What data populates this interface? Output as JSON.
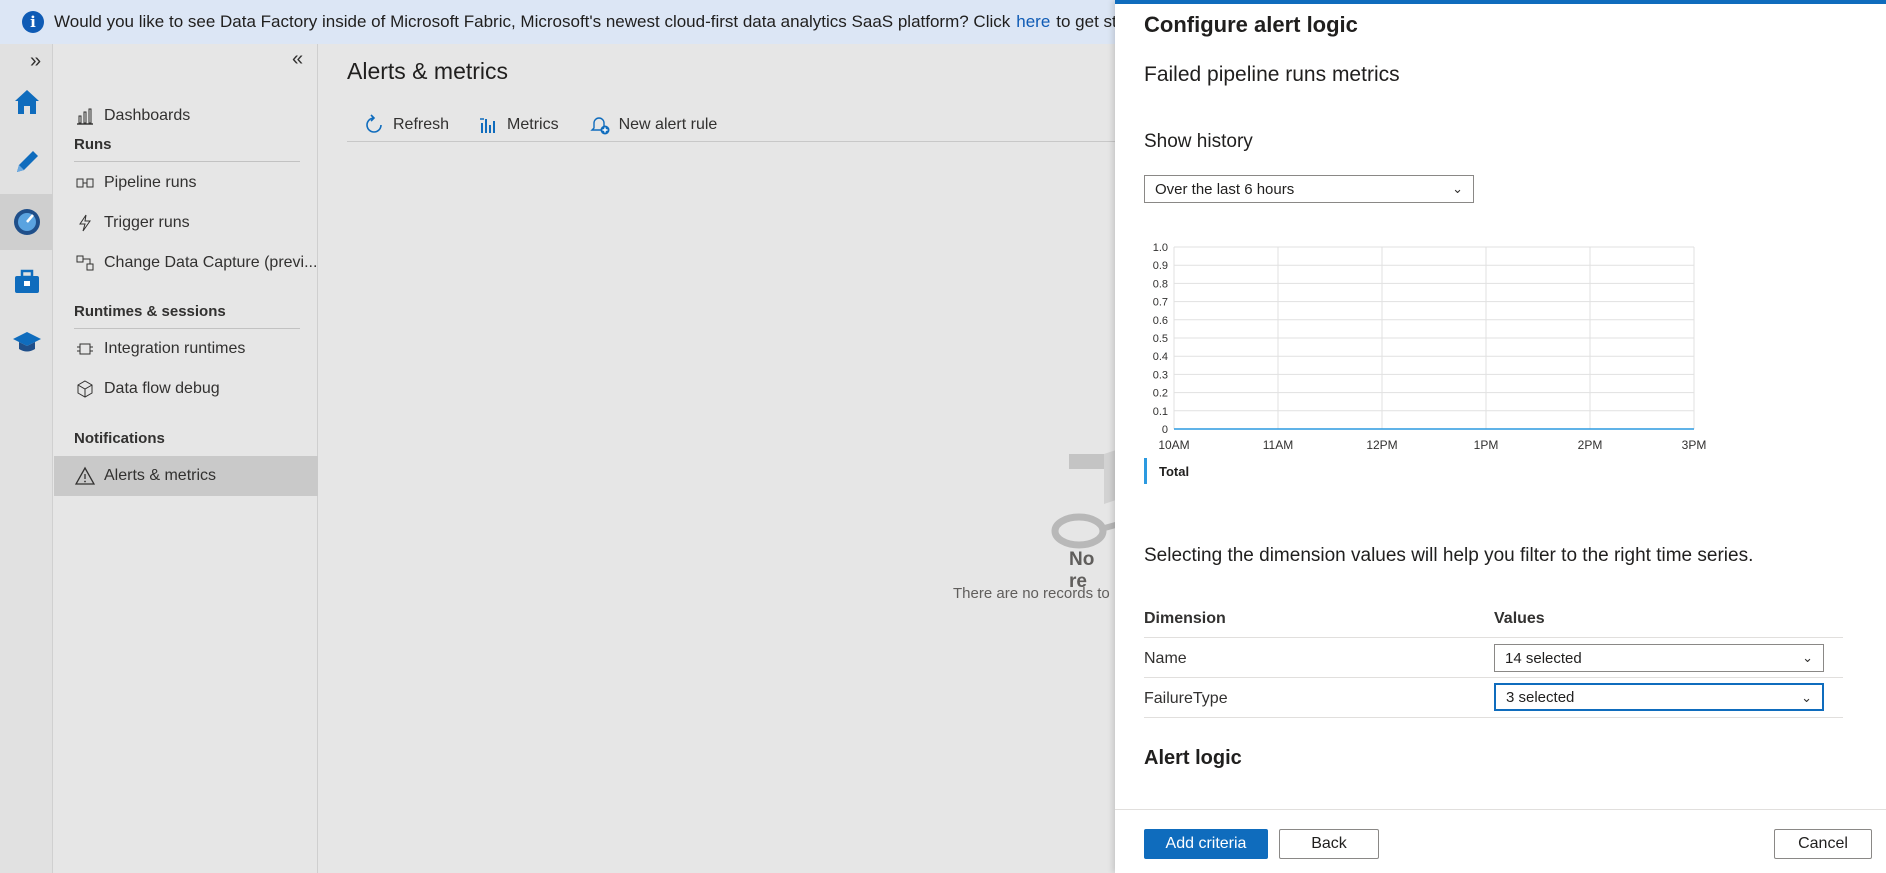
{
  "banner": {
    "text_before": "Would you like to see Data Factory inside of Microsoft Fabric, Microsoft's newest cloud-first data analytics SaaS platform? Click",
    "link": "here",
    "text_after": "to get started w"
  },
  "rail": {
    "expand_label": "»",
    "items": [
      "home-icon",
      "pencil-icon",
      "monitor-icon",
      "toolbox-icon",
      "graduation-cap-icon"
    ]
  },
  "sidebar": {
    "collapse_label": "«",
    "dashboards": "Dashboards",
    "sections": {
      "runs": "Runs",
      "runtimes": "Runtimes & sessions",
      "notifications": "Notifications"
    },
    "items": {
      "pipeline_runs": "Pipeline runs",
      "trigger_runs": "Trigger runs",
      "change_data_capture": "Change Data Capture (previ...",
      "integration_runtimes": "Integration runtimes",
      "data_flow_debug": "Data flow debug",
      "alerts_metrics": "Alerts & metrics"
    }
  },
  "main": {
    "title": "Alerts & metrics",
    "toolbar": {
      "refresh": "Refresh",
      "metrics": "Metrics",
      "new_alert_rule": "New alert rule"
    },
    "empty_title": "No re",
    "empty_sub": "There are no records to"
  },
  "panel": {
    "title": "Configure alert logic",
    "subtitle": "Failed pipeline runs metrics",
    "show_history_label": "Show history",
    "history_value": "Over the last 6 hours",
    "legend": "Total",
    "dimension_help": "Selecting the dimension values will help you filter to the right time series.",
    "dim_header": {
      "dimension": "Dimension",
      "values": "Values"
    },
    "dim_rows": [
      {
        "name": "Name",
        "value": "14 selected"
      },
      {
        "name": "FailureType",
        "value": "3 selected"
      }
    ],
    "alert_logic": "Alert logic",
    "buttons": {
      "add_criteria": "Add criteria",
      "back": "Back",
      "cancel": "Cancel"
    }
  },
  "chart_data": {
    "type": "line",
    "x": [
      "10AM",
      "11AM",
      "12PM",
      "1PM",
      "2PM",
      "3PM"
    ],
    "series": [
      {
        "name": "Total",
        "values": [
          0,
          0,
          0,
          0,
          0,
          0
        ]
      }
    ],
    "ylim": [
      0,
      1.0
    ],
    "yticks": [
      "0",
      "0.1",
      "0.2",
      "0.3",
      "0.4",
      "0.5",
      "0.6",
      "0.7",
      "0.8",
      "0.9",
      "1.0"
    ],
    "grid": true,
    "line_color": "#2c9ae0"
  },
  "colors": {
    "accent": "#0f6cbd",
    "banner_bg": "#dce6f5"
  }
}
